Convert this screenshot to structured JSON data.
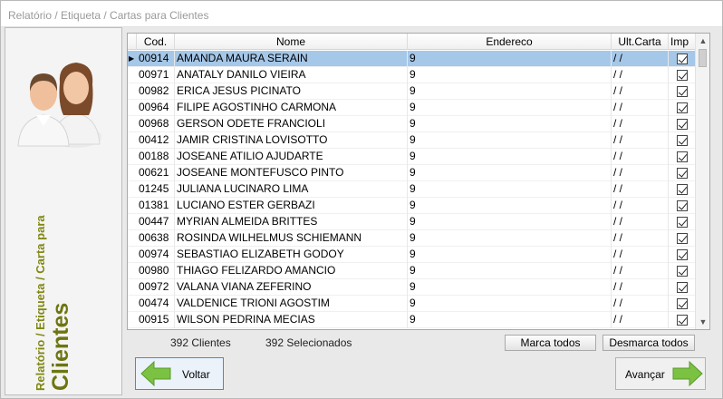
{
  "window": {
    "title": "Relatório / Etiqueta / Cartas para Clientes"
  },
  "left_panel": {
    "line1": "Relatório / Etiqueta / Carta para",
    "line2": "Clientes",
    "icon": "users-icon"
  },
  "grid": {
    "headers": {
      "cod": "Cod.",
      "nome": "Nome",
      "endereco": "Endereco",
      "ult_carta": "Ult.Carta",
      "imp": "Imp"
    },
    "rows": [
      {
        "cod": "00914",
        "nome": "AMANDA MAURA SERAIN",
        "endereco": "9",
        "ult_carta": "/ /",
        "imp": true,
        "selected": true
      },
      {
        "cod": "00971",
        "nome": "ANATALY DANILO VIEIRA",
        "endereco": "9",
        "ult_carta": "/ /",
        "imp": true
      },
      {
        "cod": "00982",
        "nome": "ERICA JESUS PICINATO",
        "endereco": "9",
        "ult_carta": "/ /",
        "imp": true
      },
      {
        "cod": "00964",
        "nome": "FILIPE AGOSTINHO CARMONA",
        "endereco": "9",
        "ult_carta": "/ /",
        "imp": true
      },
      {
        "cod": "00968",
        "nome": "GERSON ODETE FRANCIOLI",
        "endereco": "9",
        "ult_carta": "/ /",
        "imp": true
      },
      {
        "cod": "00412",
        "nome": "JAMIR CRISTINA LOVISOTTO",
        "endereco": "9",
        "ult_carta": "/ /",
        "imp": true
      },
      {
        "cod": "00188",
        "nome": "JOSEANE ATILIO AJUDARTE",
        "endereco": "9",
        "ult_carta": "/ /",
        "imp": true
      },
      {
        "cod": "00621",
        "nome": "JOSEANE MONTEFUSCO PINTO",
        "endereco": "9",
        "ult_carta": "/ /",
        "imp": true
      },
      {
        "cod": "01245",
        "nome": "JULIANA LUCINARO LIMA",
        "endereco": "9",
        "ult_carta": "/ /",
        "imp": true
      },
      {
        "cod": "01381",
        "nome": "LUCIANO ESTER GERBAZI",
        "endereco": "9",
        "ult_carta": "/ /",
        "imp": true
      },
      {
        "cod": "00447",
        "nome": "MYRIAN ALMEIDA BRITTES",
        "endereco": "9",
        "ult_carta": "/ /",
        "imp": true
      },
      {
        "cod": "00638",
        "nome": "ROSINDA WILHELMUS SCHIEMANN",
        "endereco": "9",
        "ult_carta": "/ /",
        "imp": true
      },
      {
        "cod": "00974",
        "nome": "SEBASTIAO ELIZABETH GODOY",
        "endereco": "9",
        "ult_carta": "/ /",
        "imp": true
      },
      {
        "cod": "00980",
        "nome": "THIAGO FELIZARDO AMANCIO",
        "endereco": "9",
        "ult_carta": "/ /",
        "imp": true
      },
      {
        "cod": "00972",
        "nome": "VALANA VIANA ZEFERINO",
        "endereco": "9",
        "ult_carta": "/ /",
        "imp": true
      },
      {
        "cod": "00474",
        "nome": "VALDENICE TRIONI AGOSTIM",
        "endereco": "9",
        "ult_carta": "/ /",
        "imp": true
      },
      {
        "cod": "00915",
        "nome": "WILSON PEDRINA MECIAS",
        "endereco": "9",
        "ult_carta": "/ /",
        "imp": true
      }
    ]
  },
  "footer": {
    "clientes_count": "392 Clientes",
    "selecionados_count": "392 Selecionados",
    "marca_todos": "Marca todos",
    "desmarca_todos": "Desmarca todos"
  },
  "buttons": {
    "voltar": "Voltar",
    "avancar": "Avançar"
  },
  "colors": {
    "accent_green": "#6e7510",
    "selection": "#a5c7e8",
    "arrow_green": "#7bc142"
  }
}
